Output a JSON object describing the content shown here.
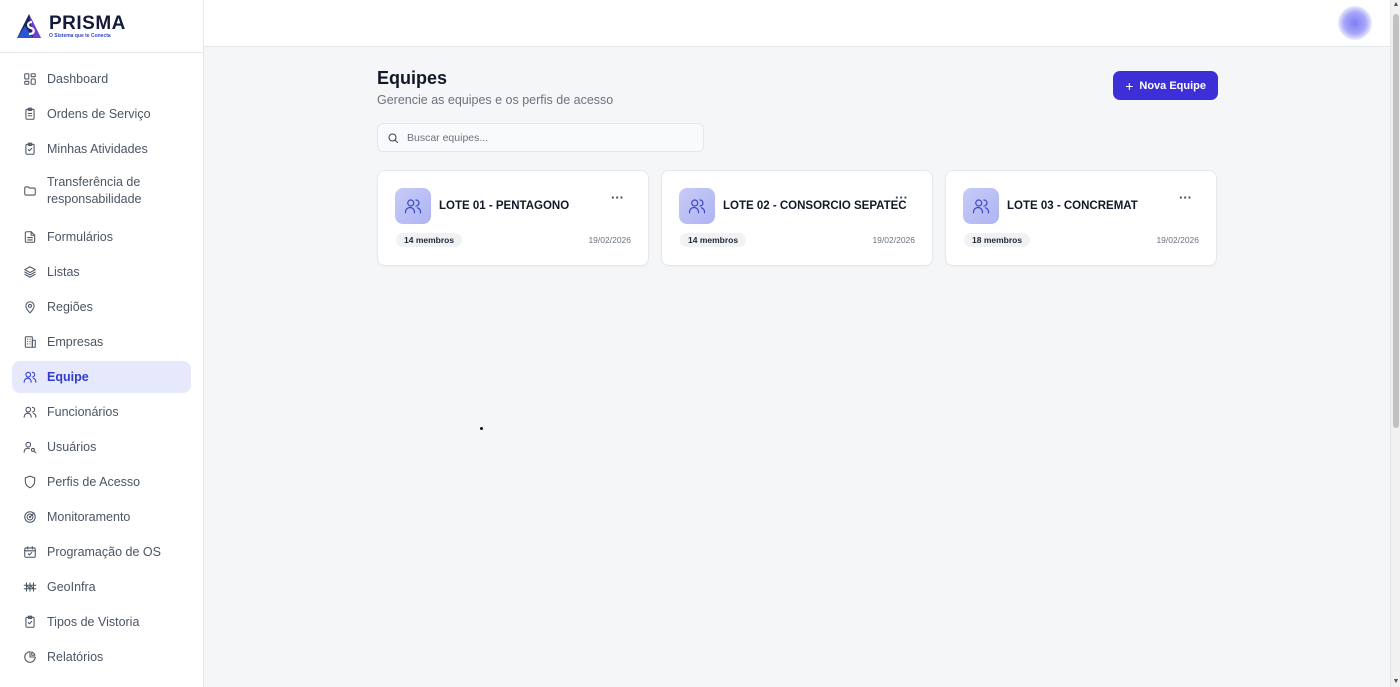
{
  "brand": {
    "name": "PRISMA",
    "tagline": "O Sistema que te Conecta"
  },
  "sidebar": {
    "items": [
      {
        "label": "Dashboard",
        "icon": "dashboard-icon"
      },
      {
        "label": "Ordens de Serviço",
        "icon": "clipboard-icon"
      },
      {
        "label": "Minhas Atividades",
        "icon": "clipboard-check-icon"
      },
      {
        "label": "Transferência de responsabilidade",
        "icon": "folder-icon"
      },
      {
        "label": "Formulários",
        "icon": "file-text-icon"
      },
      {
        "label": "Listas",
        "icon": "layers-icon"
      },
      {
        "label": "Regiões",
        "icon": "map-pin-icon"
      },
      {
        "label": "Empresas",
        "icon": "building-icon"
      },
      {
        "label": "Equipe",
        "icon": "users-icon",
        "active": true
      },
      {
        "label": "Funcionários",
        "icon": "users-icon"
      },
      {
        "label": "Usuários",
        "icon": "user-key-icon"
      },
      {
        "label": "Perfis de Acesso",
        "icon": "shield-icon"
      },
      {
        "label": "Monitoramento",
        "icon": "radar-icon"
      },
      {
        "label": "Programação de OS",
        "icon": "calendar-check-icon"
      },
      {
        "label": "GeoInfra",
        "icon": "infrastructure-icon"
      },
      {
        "label": "Tipos de Vistoria",
        "icon": "clipboard-check-icon"
      },
      {
        "label": "Relatórios",
        "icon": "pie-chart-icon"
      }
    ]
  },
  "header": {
    "title": "Equipes",
    "subtitle": "Gerencie as equipes e os perfis de acesso",
    "new_button_label": "Nova Equipe"
  },
  "search": {
    "placeholder": "Buscar equipes...",
    "value": ""
  },
  "teams": [
    {
      "name": "LOTE 01 - PENTAGONO",
      "members": "14 membros",
      "date": "19/02/2026"
    },
    {
      "name": "LOTE 02 - CONSORCIO SEPATEC",
      "members": "14 membros",
      "date": "19/02/2026"
    },
    {
      "name": "LOTE 03 - CONCREMAT",
      "members": "18 membros",
      "date": "19/02/2026"
    }
  ],
  "colors": {
    "accent": "#3d2fd8",
    "active_bg": "#e6e9fb",
    "active_text": "#2f3bd1"
  }
}
